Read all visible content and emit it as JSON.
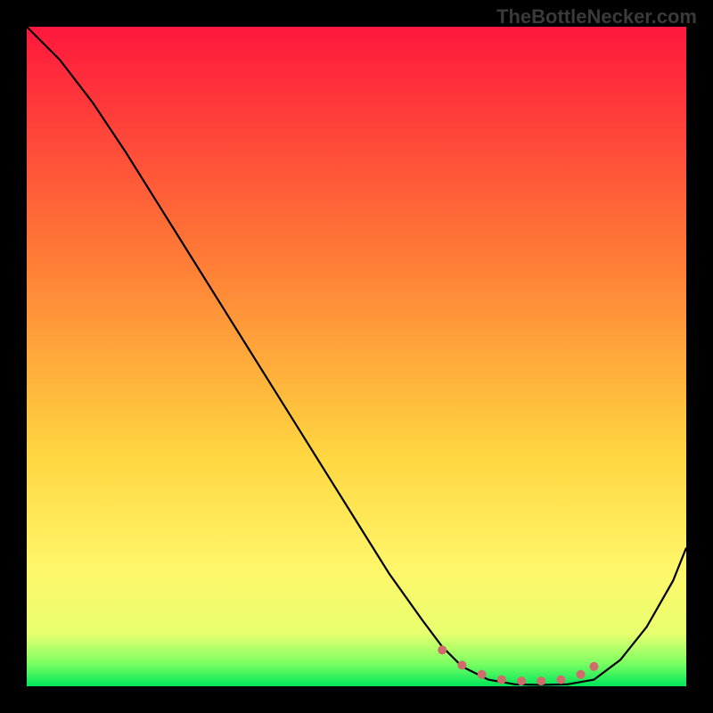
{
  "watermark": "TheBottleNecker.com",
  "chart_data": {
    "type": "line",
    "title": "",
    "xlabel": "",
    "ylabel": "",
    "xlim": [
      0,
      100
    ],
    "ylim": [
      0,
      100
    ],
    "grid": false,
    "legend": false,
    "background_gradient": {
      "stops": [
        {
          "offset": 0.0,
          "color": "#ff173d"
        },
        {
          "offset": 0.35,
          "color": "#ff7b36"
        },
        {
          "offset": 0.65,
          "color": "#ffd640"
        },
        {
          "offset": 0.82,
          "color": "#fff66a"
        },
        {
          "offset": 0.92,
          "color": "#e8ff6e"
        },
        {
          "offset": 0.965,
          "color": "#7dff62"
        },
        {
          "offset": 1.0,
          "color": "#00e65a"
        }
      ]
    },
    "series": [
      {
        "name": "bottleneck-curve",
        "color": "#000000",
        "x": [
          0,
          5,
          10,
          15,
          20,
          25,
          30,
          35,
          40,
          45,
          50,
          55,
          60,
          63,
          66,
          70,
          74,
          78,
          82,
          86,
          90,
          94,
          98,
          100
        ],
        "y": [
          100,
          95,
          88.5,
          81,
          73,
          65,
          57,
          49,
          41,
          33,
          25,
          17,
          10,
          6,
          3,
          1,
          0.3,
          0.2,
          0.3,
          1,
          4,
          9,
          16,
          21
        ]
      },
      {
        "name": "optimal-dots",
        "color": "#d16a6a",
        "type": "scatter",
        "x": [
          63,
          66,
          69,
          72,
          75,
          78,
          81,
          84,
          86
        ],
        "y": [
          5.5,
          3.2,
          1.8,
          1.0,
          0.8,
          0.8,
          1.0,
          1.8,
          3.0
        ]
      }
    ]
  }
}
